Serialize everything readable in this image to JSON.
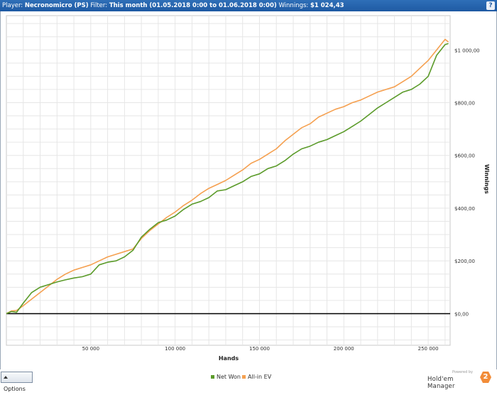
{
  "header": {
    "player_label": "Player:",
    "player_value": "Necronomicro (PS)",
    "filter_label": "Filter:",
    "filter_value": "This month (01.05.2018 0:00 to 01.06.2018 0:00)",
    "winnings_label": "Winnings:",
    "winnings_value": "$1 024,43",
    "help_label": "?"
  },
  "footer": {
    "options_label": "Options",
    "powered_by": "Powered by",
    "brand_name": "Hold'em Manager",
    "brand_version": "2"
  },
  "colors": {
    "net_won": "#5b9b2a",
    "allin_ev": "#f5a050",
    "zero_line": "#000000",
    "grid": "#e6e6e6"
  },
  "chart_data": {
    "type": "line",
    "title": "",
    "xlabel": "Hands",
    "ylabel": "Winnings",
    "xlim": [
      0,
      263000
    ],
    "ylim": [
      -120,
      1130
    ],
    "x_ticks": [
      50000,
      100000,
      150000,
      200000,
      250000
    ],
    "x_tick_labels": [
      "50 000",
      "100 000",
      "150 000",
      "200 000",
      "250 000"
    ],
    "y_ticks": [
      0,
      200,
      400,
      600,
      800,
      1000
    ],
    "y_tick_labels": [
      "$0,00",
      "$200,00",
      "$400,00",
      "$600,00",
      "$800,00",
      "$1 000,00"
    ],
    "grid": true,
    "legend_position": "bottom-center",
    "series": [
      {
        "name": "Net Won",
        "x": [
          0,
          3000,
          6000,
          10000,
          15000,
          20000,
          25000,
          30000,
          35000,
          40000,
          45000,
          50000,
          55000,
          60000,
          65000,
          70000,
          75000,
          80000,
          85000,
          90000,
          95000,
          100000,
          105000,
          110000,
          115000,
          120000,
          125000,
          130000,
          135000,
          140000,
          145000,
          150000,
          155000,
          160000,
          165000,
          170000,
          175000,
          180000,
          185000,
          190000,
          195000,
          200000,
          205000,
          210000,
          215000,
          220000,
          225000,
          230000,
          235000,
          240000,
          245000,
          250000,
          255000,
          260000,
          262000
        ],
        "values": [
          0,
          8,
          5,
          40,
          80,
          100,
          110,
          120,
          128,
          135,
          140,
          150,
          185,
          195,
          200,
          215,
          240,
          290,
          320,
          345,
          355,
          370,
          395,
          415,
          425,
          440,
          465,
          470,
          485,
          500,
          520,
          530,
          550,
          560,
          580,
          605,
          625,
          635,
          650,
          660,
          675,
          690,
          710,
          730,
          755,
          780,
          800,
          820,
          840,
          850,
          870,
          900,
          980,
          1020,
          1024
        ]
      },
      {
        "name": "All-in EV",
        "x": [
          0,
          3000,
          6000,
          10000,
          15000,
          20000,
          25000,
          30000,
          35000,
          40000,
          45000,
          50000,
          55000,
          60000,
          65000,
          70000,
          75000,
          80000,
          85000,
          90000,
          95000,
          100000,
          105000,
          110000,
          115000,
          120000,
          125000,
          130000,
          135000,
          140000,
          145000,
          150000,
          155000,
          160000,
          165000,
          170000,
          175000,
          180000,
          185000,
          190000,
          195000,
          200000,
          205000,
          210000,
          215000,
          220000,
          225000,
          230000,
          235000,
          240000,
          245000,
          250000,
          255000,
          260000,
          262000
        ],
        "values": [
          0,
          10,
          12,
          30,
          55,
          80,
          105,
          130,
          150,
          165,
          175,
          185,
          200,
          215,
          225,
          235,
          245,
          285,
          315,
          340,
          365,
          385,
          410,
          430,
          455,
          475,
          490,
          505,
          525,
          545,
          570,
          585,
          605,
          625,
          655,
          680,
          705,
          720,
          745,
          760,
          775,
          785,
          800,
          810,
          825,
          840,
          850,
          860,
          880,
          900,
          930,
          960,
          1000,
          1040,
          1030
        ]
      }
    ]
  }
}
